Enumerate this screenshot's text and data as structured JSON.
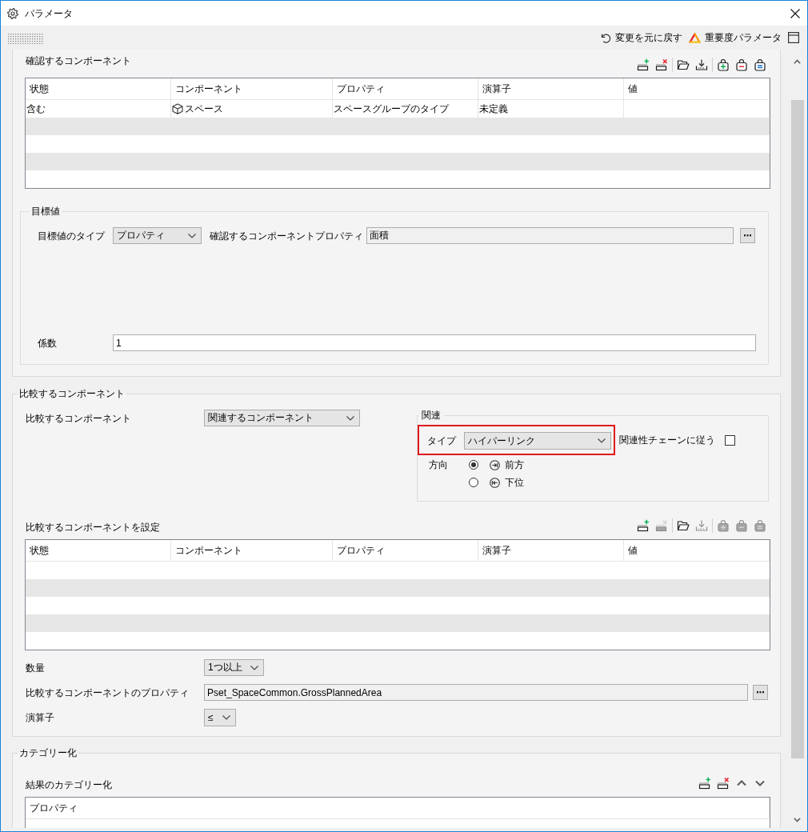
{
  "window": {
    "title": "パラメータ"
  },
  "toolbar": [
    {
      "kind": "undo",
      "label": "変更を元に戻す"
    },
    {
      "kind": "severity",
      "label": "重要度パラメータ"
    },
    {
      "kind": "layout"
    }
  ],
  "check_components": {
    "title": "確認するコンポーネント",
    "tool_groups": [
      {
        "tools": [
          {
            "kind": "add-row",
            "disabled": false
          },
          {
            "kind": "delete-row",
            "disabled": false
          }
        ]
      },
      {
        "tools": [
          {
            "kind": "open",
            "disabled": false
          },
          {
            "kind": "download",
            "disabled": false
          }
        ]
      },
      {
        "tools": [
          {
            "kind": "bag-plus",
            "disabled": false
          },
          {
            "kind": "bag-minus",
            "disabled": false
          },
          {
            "kind": "bag-equal",
            "disabled": false
          }
        ]
      }
    ],
    "table": {
      "columns": [
        "状態",
        "コンポーネント",
        "プロパティ",
        "演算子",
        "値"
      ],
      "rows": [
        {
          "state": "含む",
          "component": "スペース",
          "property": "スペースグループのタイプ",
          "operator": "未定義"
        }
      ]
    },
    "target": {
      "title": "目標値",
      "type": {
        "label": "目標値のタイプ",
        "value": "プロパティ"
      },
      "property": {
        "label": "確認するコンポーネントプロパティ",
        "value": "面積",
        "readonly": true
      },
      "factor": {
        "label": "係数",
        "value": "1",
        "readonly": false
      }
    }
  },
  "compare": {
    "title": "比較するコンポーネント",
    "component": {
      "label": "比較するコンポーネント",
      "value": "関連するコンポーネント"
    },
    "relation": {
      "title": "関連",
      "type": {
        "label": "タイプ",
        "value": "ハイパーリンク",
        "highlighted": true
      },
      "follow_chain": {
        "label": "関連性チェーンに従う",
        "checked": false
      },
      "direction": {
        "label": "方向",
        "options": [
          {
            "kind": "forward",
            "label": "前方",
            "selected": true
          },
          {
            "kind": "down",
            "label": "下位",
            "selected": false
          }
        ]
      }
    },
    "set": {
      "title": "比較するコンポーネントを設定",
      "tool_groups": [
        {
          "tools": [
            {
              "kind": "add-row",
              "disabled": false
            },
            {
              "kind": "delete-row",
              "disabled": true
            }
          ]
        },
        {
          "tools": [
            {
              "kind": "open",
              "disabled": false
            },
            {
              "kind": "download",
              "disabled": true
            }
          ]
        },
        {
          "tools": [
            {
              "kind": "bag-plus",
              "disabled": true
            },
            {
              "kind": "bag-minus",
              "disabled": true
            },
            {
              "kind": "bag-equal",
              "disabled": true
            }
          ]
        }
      ],
      "table": {
        "columns": [
          "状態",
          "コンポーネント",
          "プロパティ",
          "演算子",
          "値"
        ]
      }
    },
    "quantity": {
      "label": "数量",
      "value": "1つ以上"
    },
    "property": {
      "label": "比較するコンポーネントのプロパティ",
      "value": "Pset_SpaceCommon.GrossPlannedArea",
      "readonly": true
    },
    "operator": {
      "label": "演算子",
      "value": "≤"
    }
  },
  "categorize": {
    "title": "カテゴリー化",
    "result": {
      "title": "結果のカテゴリー化",
      "tool_groups": [
        {
          "tools": [
            {
              "kind": "add-row",
              "disabled": false
            },
            {
              "kind": "delete-row",
              "disabled": false
            },
            {
              "kind": "move-up",
              "disabled": false
            },
            {
              "kind": "move-down",
              "disabled": false
            }
          ]
        }
      ],
      "table": {
        "columns": [
          "プロパティ"
        ]
      }
    }
  }
}
